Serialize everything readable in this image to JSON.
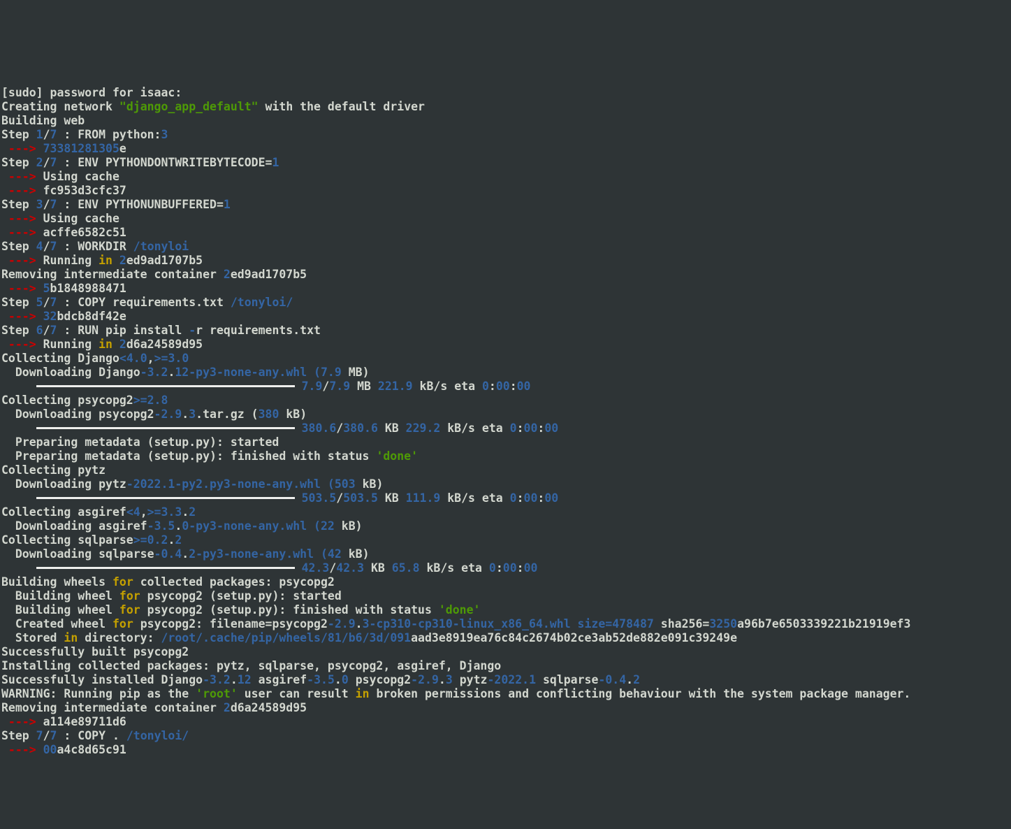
{
  "sudo_prompt": "[sudo] password for isaac:",
  "network_line_a": "Creating network ",
  "network_name": "\"django_app_default\"",
  "network_line_b": " with the default driver",
  "building_web": "Building web",
  "s1": {
    "label": "Step ",
    "n": "1",
    "sep": "/",
    "t": "7",
    "rest": " : FROM python:",
    "tag": "3",
    "hash_pre": "73381281305",
    "hash_suf": "e"
  },
  "s2": {
    "label": "Step ",
    "n": "2",
    "sep": "/",
    "t": "7",
    "rest": " : ENV PYTHONDONTWRITEBYTECODE=",
    "val": "1",
    "cache": "Using cache",
    "hash": "fc953d3cfc37"
  },
  "s3": {
    "label": "Step ",
    "n": "3",
    "sep": "/",
    "t": "7",
    "rest": " : ENV PYTHONUNBUFFERED=",
    "val": "1",
    "cache": "Using cache",
    "hash": "acffe6582c51"
  },
  "s4": {
    "label": "Step ",
    "n": "4",
    "sep": "/",
    "t": "7",
    "rest": " : WORKDIR ",
    "dir": "/tonyloi",
    "run": "Running ",
    "in": "in ",
    "id_pre": "2",
    "id_suf": "ed9ad1707b5",
    "rm": "Removing intermediate container ",
    "rmid_pre": "2",
    "rmid_suf": "ed9ad1707b5",
    "hash_pre": "5",
    "hash_suf": "b1848988471"
  },
  "s5": {
    "label": "Step ",
    "n": "5",
    "sep": "/",
    "t": "7",
    "rest": " : COPY requirements.txt ",
    "dir": "/tonyloi/",
    "hash_pre": "32",
    "hash_suf": "bdcb8df42e"
  },
  "s6": {
    "label": "Step ",
    "n": "6",
    "sep": "/",
    "t": "7",
    "rest": " : RUN pip install ",
    "flag": "-",
    "flag2": "r requirements.txt",
    "run": "Running ",
    "in": "in ",
    "id_pre": "2",
    "id_suf": "d6a24589d95"
  },
  "django": {
    "collect": "Collecting Django",
    "lt": "<",
    "v1": "4.0",
    "comma": ",",
    "ge": ">=",
    "v2": "3.0",
    "dl": "  Downloading Django",
    "dash": "-",
    "ver": "3.2",
    "dot": ".",
    "patch": "12",
    "suffix": "-py3-none-any.whl (",
    "size": "7.9",
    "unit": " MB)",
    "prog_a": "7.9",
    "slash": "/",
    "prog_b": "7.9",
    "mb": " MB ",
    "rate": "221.9",
    "kbs": " kB/s eta ",
    "eta": "0",
    "etacol": ":",
    "eta2": "00",
    "etacol2": ":",
    "eta3": "00"
  },
  "psycopg2": {
    "collect": "Collecting psycopg2",
    "ge": ">=",
    "v": "2.8",
    "dl": "  Downloading psycopg2",
    "dash": "-",
    "ver": "2.9",
    "dot": ".",
    "patch": "3",
    "tar": ".tar.gz (",
    "size": "380",
    "unit": " kB)",
    "prog_a": "380.6",
    "slash": "/",
    "prog_b": "380.6",
    "kb": " KB ",
    "rate": "229.2",
    "kbs": " kB/s eta ",
    "eta": "0",
    "etacol": ":",
    "eta2": "00",
    "etacol2": ":",
    "eta3": "00",
    "prep1": "  Preparing metadata (setup.py): started",
    "prep2": "  Preparing metadata (setup.py): finished with status ",
    "done": "'done'"
  },
  "pytz": {
    "collect": "Collecting pytz",
    "dl": "  Downloading pytz",
    "dash": "-",
    "ver": "2022.1",
    "suffix": "-py2.py3-none-any.whl (",
    "size": "503",
    "unit": " kB)",
    "prog_a": "503.5",
    "slash": "/",
    "prog_b": "503.5",
    "kb": " KB ",
    "rate": "111.9",
    "kbs": " kB/s eta ",
    "eta": "0",
    "etacol": ":",
    "eta2": "00",
    "etacol2": ":",
    "eta3": "00"
  },
  "asgiref": {
    "collect": "Collecting asgiref",
    "lt": "<",
    "v1": "4",
    "comma": ",",
    "ge": ">=",
    "v2": "3.3",
    "dot": ".",
    "v3": "2",
    "dl": "  Downloading asgiref",
    "dash": "-",
    "ver": "3.5",
    "dot2": ".",
    "patch": "0",
    "suffix": "-py3-none-any.whl (",
    "size": "22",
    "unit": " kB)"
  },
  "sqlparse": {
    "collect": "Collecting sqlparse",
    "ge": ">=",
    "v": "0.2",
    "dot": ".",
    "v2": "2",
    "dl": "  Downloading sqlparse",
    "dash": "-",
    "ver": "0.4",
    "dot2": ".",
    "patch": "2",
    "suffix": "-py3-none-any.whl (",
    "size": "42",
    "unit": " kB)",
    "prog_a": "42.3",
    "slash": "/",
    "prog_b": "42.3",
    "kb": " KB ",
    "rate": "65.8",
    "kbs": " kB/s eta ",
    "eta": "0",
    "etacol": ":",
    "eta2": "00",
    "etacol2": ":",
    "eta3": "00"
  },
  "wheels": {
    "l1a": "Building wheels ",
    "for": "for",
    "l1b": " collected packages: psycopg2",
    "l2a": "  Building wheel ",
    "l2b": " psycopg2 (setup.py): started",
    "l3a": "  Building wheel ",
    "l3b": " psycopg2 (setup.py): finished with status ",
    "done": "'done'",
    "l4a": "  Created wheel ",
    "l4b": " psycopg2: filename=psycopg2",
    "dash": "-",
    "ver": "2.9",
    "dot": ".",
    "patch": "3",
    "l4c": "-cp310-cp310-linux_x86_64.whl size=",
    "size": "478487",
    "sha": " sha256=",
    "sha_pre": "3250",
    "sha_suf": "a96b7e6503339221b21919ef3",
    "l5a": "  Stored ",
    "in": "in",
    "l5b": " directory: ",
    "path": "/root/.cache/pip/wheels/81/b6/3d/091",
    "path_suf": "aad3e8919ea76c84c2674b02ce3ab52de882e091c39249e"
  },
  "built": "Successfully built psycopg2",
  "installing": "Installing collected packages: pytz, sqlparse, psycopg2, asgiref, Django",
  "success": {
    "pre": "Successfully installed Django",
    "d": "-",
    "dv": "3.2",
    "dot": ".",
    "dp": "12",
    "a": " asgiref",
    "av": "3.5",
    "ap": "0",
    "p": " psycopg2",
    "pv": "2.9",
    "pp": "3",
    "z": " pytz",
    "zv": "2022.1",
    "s": " sqlparse",
    "sv": "0.4",
    "sp": "2"
  },
  "warning": {
    "pre": "WARNING: Running pip as the ",
    "root": "'root'",
    "mid": " user can result ",
    "in": "in",
    "post": " broken permissions and conflicting behaviour with the system package manager."
  },
  "rm6": {
    "txt": "Removing intermediate container ",
    "id_pre": "2",
    "id_suf": "d6a24589d95",
    "hash": "a114e89711d6"
  },
  "s7": {
    "label": "Step ",
    "n": "7",
    "sep": "/",
    "t": "7",
    "rest": " : COPY . ",
    "dir": "/tonyloi/",
    "hash_pre": "00",
    "hash_suf": "a4c8d65c91"
  },
  "arrow": " ---> ",
  "barpad": "     ",
  "barwidth": "370px"
}
